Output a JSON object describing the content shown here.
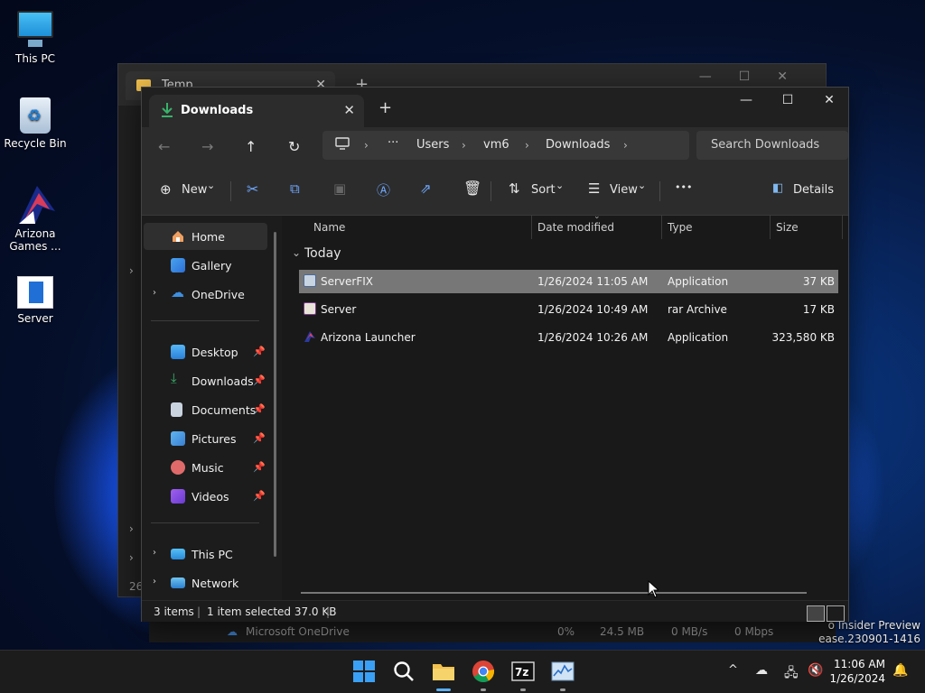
{
  "desktop": {
    "icons": [
      {
        "label": "This PC"
      },
      {
        "label": "Recycle Bin"
      },
      {
        "label": "Arizona Games ..."
      },
      {
        "label": "Server"
      }
    ]
  },
  "back_window": {
    "tab_title": "Temp",
    "tab_close": "✕",
    "new_tab": "+",
    "count_text": "26"
  },
  "task_manager_row": {
    "name": "Microsoft OneDrive",
    "cpu": "0%",
    "memory": "24.5 MB",
    "disk": "0 MB/s",
    "network": "0 Mbps"
  },
  "watermark": {
    "line1": "o Insider Preview",
    "line2": "ease.230901-1416"
  },
  "window": {
    "tab_title": "Downloads",
    "tab_close": "✕",
    "new_tab": "+",
    "controls": {
      "minimize": "—",
      "maximize": "☐",
      "close": "✕"
    },
    "nav": {
      "back": "←",
      "forward": "→",
      "up": "↑",
      "refresh": "↻"
    },
    "address": {
      "more": "···",
      "crumbs": [
        "Users",
        "vm6",
        "Downloads"
      ],
      "sep": "›"
    },
    "search_placeholder": "Search Downloads",
    "commands": {
      "new": "New",
      "sort": "Sort",
      "view": "View",
      "more": "•••",
      "details": "Details",
      "caret": "⌄"
    },
    "sidebar": {
      "items": [
        {
          "label": "Home"
        },
        {
          "label": "Gallery"
        },
        {
          "label": "OneDrive"
        },
        {
          "label": "Desktop"
        },
        {
          "label": "Downloads"
        },
        {
          "label": "Documents"
        },
        {
          "label": "Pictures"
        },
        {
          "label": "Music"
        },
        {
          "label": "Videos"
        },
        {
          "label": "This PC"
        },
        {
          "label": "Network"
        }
      ],
      "pin": "📌",
      "expand": "›"
    },
    "columns": {
      "name": "Name",
      "date": "Date modified",
      "type": "Type",
      "size": "Size"
    },
    "group": {
      "label": "Today",
      "toggle": "⌄"
    },
    "files": [
      {
        "name": "ServerFIX",
        "date": "1/26/2024 11:05 AM",
        "type": "Application",
        "size": "37 KB"
      },
      {
        "name": "Server",
        "date": "1/26/2024 10:49 AM",
        "type": "rar Archive",
        "size": "17 KB"
      },
      {
        "name": "Arizona Launcher",
        "date": "1/26/2024 10:26 AM",
        "type": "Application",
        "size": "323,580 KB"
      }
    ],
    "status": {
      "count": "3 items",
      "selected": "1 item selected  37.0 KB",
      "bar": "|"
    }
  },
  "taskbar": {
    "tray_chevron": "^",
    "time": "11:06 AM",
    "date": "1/26/2024"
  },
  "colors": {
    "accent": "#5ab1f5",
    "selection": "#777777",
    "folder": "#f2c14e",
    "download_green": "#38b26a"
  }
}
